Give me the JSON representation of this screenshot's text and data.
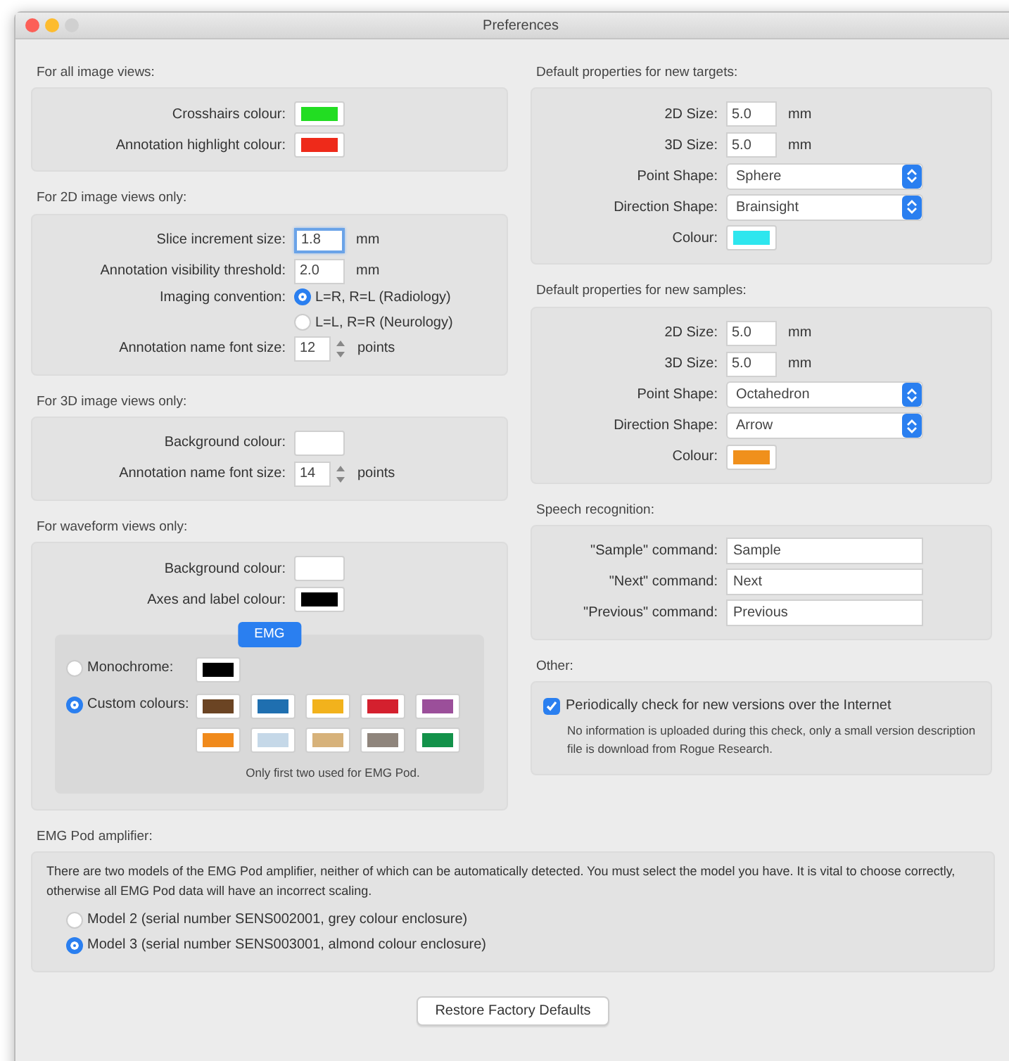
{
  "window": {
    "title": "Preferences"
  },
  "left_sections": [
    {
      "title": "For all image views:",
      "rows": [
        {
          "kind": "color",
          "label": "Crosshairs colour:",
          "color": "#22dd22"
        },
        {
          "kind": "color",
          "label": "Annotation highlight colour:",
          "color": "#ee2a1a"
        }
      ]
    },
    {
      "title": "For 2D image views only:",
      "rows": [
        {
          "kind": "number",
          "label": "Slice increment size:",
          "value": "1.8",
          "unit": "mm",
          "focused": true
        },
        {
          "kind": "number",
          "label": "Annotation visibility threshold:",
          "value": "2.0",
          "unit": "mm",
          "focused": false
        },
        {
          "kind": "radio",
          "label": "Imaging convention:",
          "options": [
            {
              "label": "L=R, R=L (Radiology)",
              "selected": true
            },
            {
              "label": "L=L, R=R (Neurology)",
              "selected": false
            }
          ]
        },
        {
          "kind": "stepper",
          "label": "Annotation name font size:",
          "value": "12",
          "unit": "points"
        }
      ]
    },
    {
      "title": "For 3D image views only:",
      "rows": [
        {
          "kind": "color",
          "label": "Background colour:",
          "color": "#ffffff"
        },
        {
          "kind": "stepper",
          "label": "Annotation name font size:",
          "value": "14",
          "unit": "points"
        }
      ]
    },
    {
      "title": "For waveform views only:",
      "rows": [
        {
          "kind": "color",
          "label": "Background colour:",
          "color": "#ffffff"
        },
        {
          "kind": "color",
          "label": "Axes and label colour:",
          "color": "#000000"
        }
      ],
      "tab_group": {
        "tabs": [
          {
            "label": "EMG",
            "selected": true
          }
        ],
        "modes": [
          {
            "label": "Monochrome:",
            "selected": false,
            "swatches": [
              {
                "color": "#000000"
              }
            ]
          },
          {
            "label": "Custom colours:",
            "selected": true,
            "swatches": [
              {
                "color": "#6b4423"
              },
              {
                "color": "#1f6fb0"
              },
              {
                "color": "#f2b21c"
              },
              {
                "color": "#d4202e"
              },
              {
                "color": "#9b4f9a"
              },
              {
                "color": "#f08a1c"
              },
              {
                "color": "#c5d8e8"
              },
              {
                "color": "#d7b27a"
              },
              {
                "color": "#8f857c"
              },
              {
                "color": "#13924a"
              }
            ]
          }
        ],
        "note": "Only first two used for EMG Pod."
      }
    }
  ],
  "right_sections": [
    {
      "title": "Default properties for new targets:",
      "rows": [
        {
          "kind": "number",
          "label": "2D Size:",
          "value": "5.0",
          "unit": "mm",
          "focused": false
        },
        {
          "kind": "number",
          "label": "3D Size:",
          "value": "5.0",
          "unit": "mm",
          "focused": false
        },
        {
          "kind": "select",
          "label": "Point Shape:",
          "value": "Sphere"
        },
        {
          "kind": "select",
          "label": "Direction Shape:",
          "value": "Brainsight"
        },
        {
          "kind": "color",
          "label": "Colour:",
          "color": "#2ee6ee"
        }
      ]
    },
    {
      "title": "Default properties for new samples:",
      "rows": [
        {
          "kind": "number",
          "label": "2D Size:",
          "value": "5.0",
          "unit": "mm",
          "focused": false
        },
        {
          "kind": "number",
          "label": "3D Size:",
          "value": "5.0",
          "unit": "mm",
          "focused": false
        },
        {
          "kind": "select",
          "label": "Point Shape:",
          "value": "Octahedron"
        },
        {
          "kind": "select",
          "label": "Direction Shape:",
          "value": "Arrow"
        },
        {
          "kind": "color",
          "label": "Colour:",
          "color": "#f0901c"
        }
      ]
    },
    {
      "title": "Speech recognition:",
      "rows": [
        {
          "kind": "text",
          "label": "\"Sample\" command:",
          "value": "Sample"
        },
        {
          "kind": "text",
          "label": "\"Next\" command:",
          "value": "Next"
        },
        {
          "kind": "text",
          "label": "\"Previous\" command:",
          "value": "Previous"
        }
      ]
    },
    {
      "title": "Other:",
      "rows": [
        {
          "kind": "checkbox",
          "label": "Periodically check for new versions over the Internet",
          "checked": true,
          "note": "No information is uploaded during this check, only a small version description file is download from Rogue Research."
        }
      ]
    }
  ],
  "emg_pod": {
    "title": "EMG Pod amplifier:",
    "description": "There are two models of the EMG Pod amplifier, neither of which can be automatically detected. You must select the model you have. It is vital to choose correctly, otherwise all EMG Pod data will have an incorrect scaling.",
    "options": [
      {
        "label": "Model 2 (serial number SENS002001, grey colour enclosure)",
        "selected": false
      },
      {
        "label": "Model 3 (serial number SENS003001, almond colour enclosure)",
        "selected": true
      }
    ]
  },
  "buttons": [
    {
      "label": "Restore Factory Defaults"
    }
  ]
}
